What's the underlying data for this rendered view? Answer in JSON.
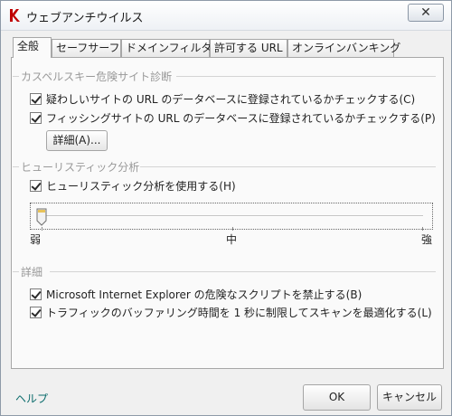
{
  "window": {
    "title": "ウェブアンチウイルス",
    "close_label": "✕",
    "accent": "#c00000"
  },
  "tabs": [
    {
      "label": "全般",
      "active": true
    },
    {
      "label": "セーフサーフ",
      "active": false
    },
    {
      "label": "ドメインフィルター",
      "active": false
    },
    {
      "label": "許可する URL",
      "active": false
    },
    {
      "label": "オンラインバンキング",
      "active": false
    }
  ],
  "sections": {
    "phishing": {
      "title": "カスペルスキー危険サイト診断",
      "options": [
        {
          "label": "疑わしいサイトの URL のデータベースに登録されているかチェックする(C)",
          "checked": true
        },
        {
          "label": "フィッシングサイトの URL のデータベースに登録されているかチェックする(P)",
          "checked": true
        }
      ],
      "detail_button": "詳細(A)..."
    },
    "heuristic": {
      "title": "ヒューリスティック分析",
      "option": {
        "label": "ヒューリスティック分析を使用する(H)",
        "checked": true
      },
      "slider": {
        "level": 0,
        "levels": 3,
        "labels": [
          "弱",
          "中",
          "強"
        ]
      }
    },
    "advanced": {
      "title": "詳細",
      "options": [
        {
          "label": "Microsoft Internet Explorer の危険なスクリプトを禁止する(B)",
          "checked": true
        },
        {
          "label": "トラフィックのバッファリング時間を 1 秒に制限してスキャンを最適化する(L)",
          "checked": true
        }
      ]
    }
  },
  "footer": {
    "help": "ヘルプ",
    "ok": "OK",
    "cancel": "キャンセル"
  }
}
